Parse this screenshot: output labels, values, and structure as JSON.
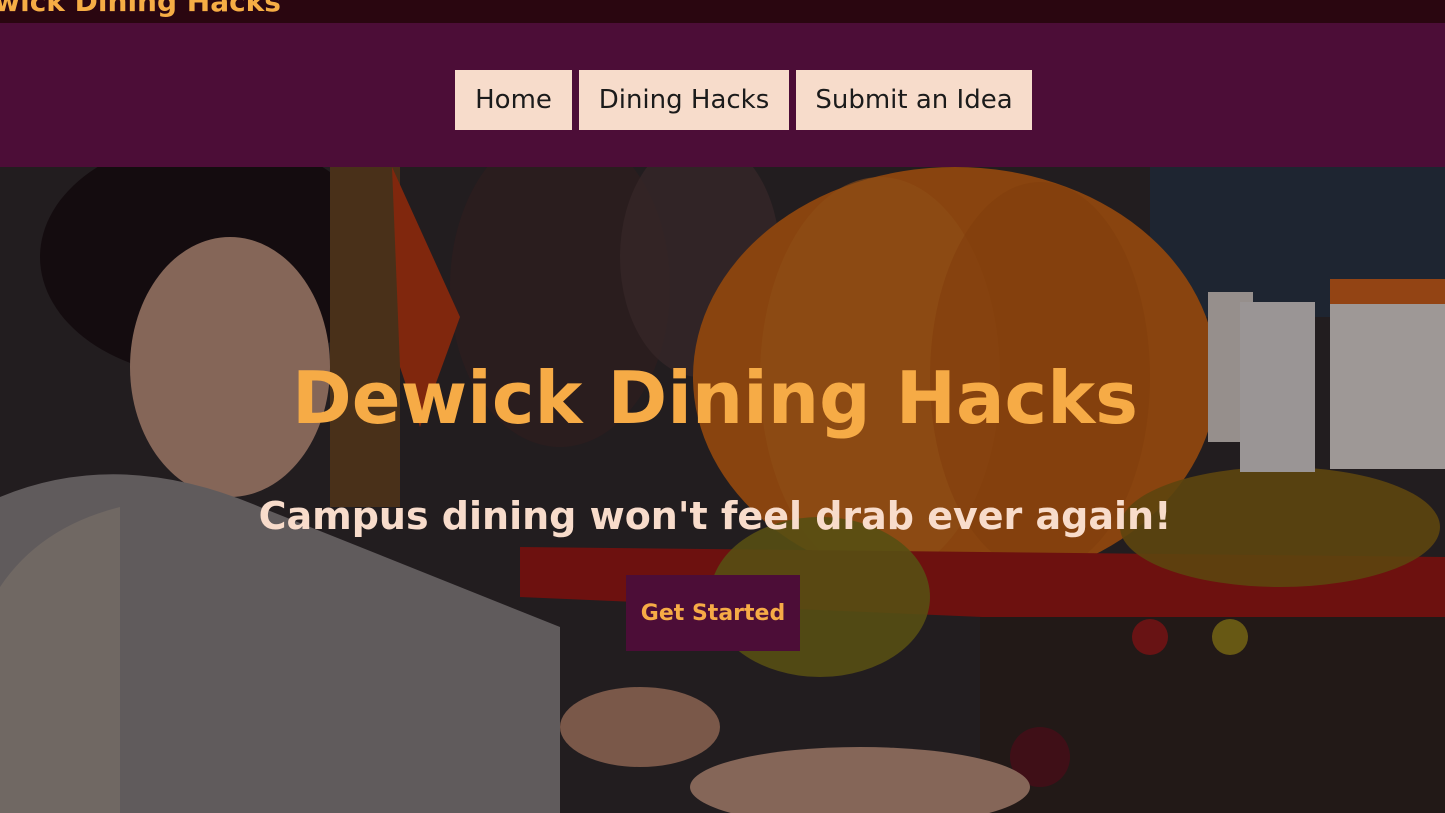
{
  "site": {
    "title": "Dewick Dining Hacks"
  },
  "nav": {
    "items": [
      {
        "label": "Home"
      },
      {
        "label": "Dining Hacks"
      },
      {
        "label": "Submit an Idea"
      }
    ]
  },
  "hero": {
    "title": "Dewick Dining Hacks",
    "subtitle": "Campus dining won't feel drab ever again!",
    "cta_label": "Get Started",
    "image_alt": "Students at a dining hall buffet with a pumpkin display"
  },
  "colors": {
    "brand_plum": "#4c0d37",
    "accent_orange": "#f6ab46",
    "nav_button_bg": "#f7dccb",
    "top_strip": "#2a0610"
  }
}
